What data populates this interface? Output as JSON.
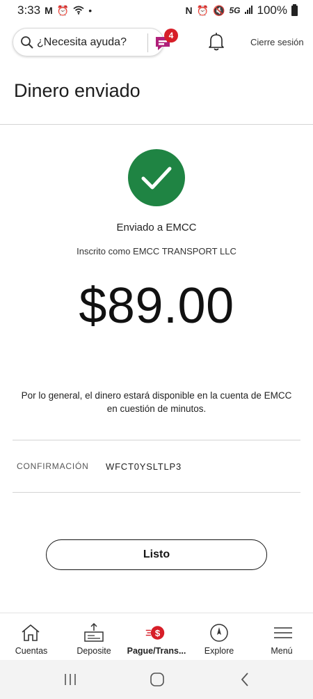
{
  "status_bar": {
    "time": "3:33",
    "network": "5G",
    "battery": "100%"
  },
  "header": {
    "search_placeholder": "¿Necesita ayuda?",
    "chat_badge_count": "4",
    "sign_out_label": "Cierre sesión"
  },
  "page": {
    "title": "Dinero enviado"
  },
  "confirmation": {
    "sent_to": "Enviado a EMCC",
    "enrolled_as": "Inscrito como EMCC TRANSPORT LLC",
    "amount": "$89.00",
    "availability_line1": "Por lo general, el dinero estará disponible en la cuenta de EMCC",
    "availability_line2": "en cuestión de minutos.",
    "confirmation_label": "CONFIRMACIÓN",
    "confirmation_code": "WFCT0YSLTLP3",
    "done_label": "Listo"
  },
  "bottom_nav": {
    "items": [
      {
        "label": "Cuentas",
        "icon": "home-icon"
      },
      {
        "label": "Deposite",
        "icon": "deposit-icon"
      },
      {
        "label": "Pague/Trans...",
        "icon": "pay-transfer-icon"
      },
      {
        "label": "Explore",
        "icon": "compass-icon"
      },
      {
        "label": "Menú",
        "icon": "menu-icon"
      }
    ]
  },
  "colors": {
    "success_green": "#1f8443",
    "brand_red": "#d71e28",
    "chat_purple": "#b0207a"
  }
}
